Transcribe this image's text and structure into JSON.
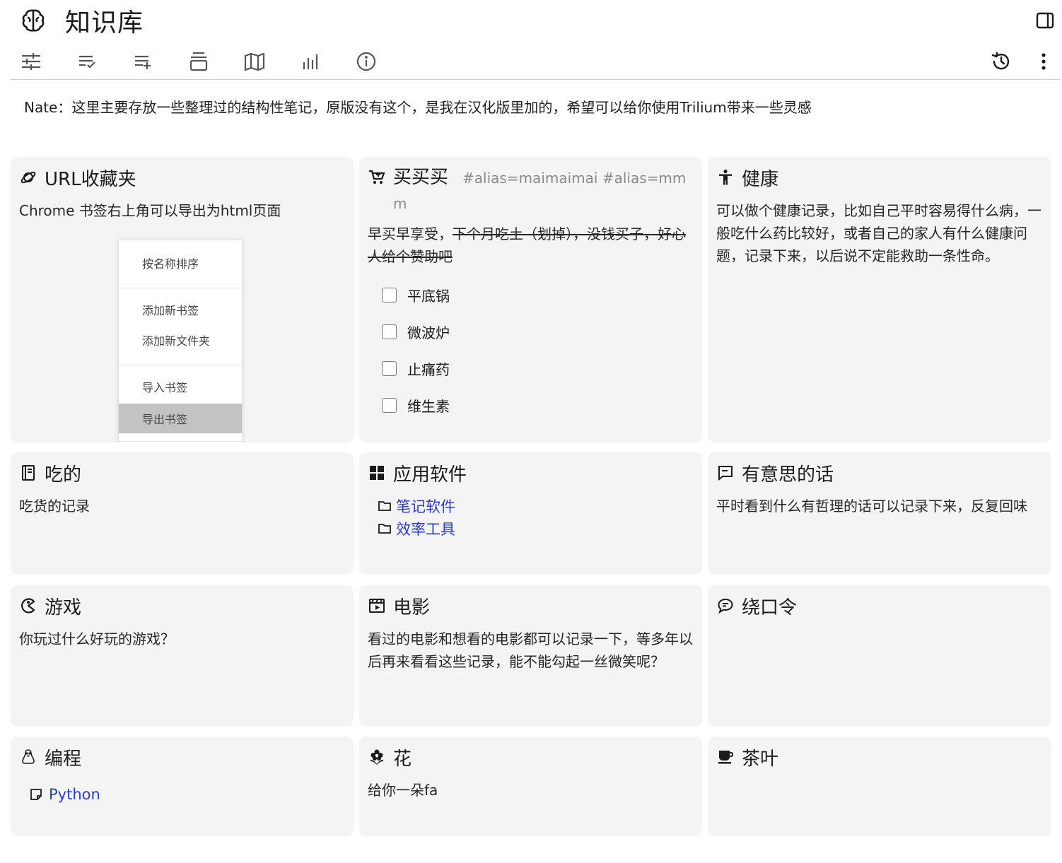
{
  "header": {
    "title": "知识库",
    "title_icon": "brain-icon",
    "sidebar_toggle_icon": "sidebar-toggle-icon"
  },
  "toolbar": {
    "left_icons": [
      "sliders-icon",
      "list-check-icon",
      "list-add-icon",
      "archive-icon",
      "map-icon",
      "bar-chart-icon",
      "info-icon"
    ],
    "right_icons": [
      "history-icon",
      "more-vertical-icon"
    ]
  },
  "note": "Nate：这里主要存放一些整理过的结构性笔记，原版没有这个，是我在汉化版里加的，希望可以给你使用Trilium带来一些灵感",
  "cards": {
    "url": {
      "title": "URL收藏夹",
      "icon": "planet-icon",
      "text": "Chrome 书签右上角可以导出为html页面",
      "menu": [
        "按名称排序",
        "添加新书签",
        "添加新文件夹",
        "导入书签",
        "导出书签"
      ]
    },
    "buy": {
      "title": "买买买",
      "icon": "cart-icon",
      "alias": "#alias=maimaimai #alias=mmm",
      "text_plain": "早买早享受，",
      "text_strike": "下个月吃土（划掉），没钱买子，好心人给个赞助吧",
      "items": [
        "平底锅",
        "微波炉",
        "止痛药",
        "维生素"
      ]
    },
    "health": {
      "title": "健康",
      "icon": "accessibility-icon",
      "text": "可以做个健康记录，比如自己平时容易得什么病，一般吃什么药比较好，或者自己的家人有什么健康问题，记录下来，以后说不定能救助一条性命。"
    },
    "food": {
      "title": "吃的",
      "icon": "notebook-icon",
      "text": "吃货的记录"
    },
    "apps": {
      "title": "应用软件",
      "icon": "windows-icon",
      "links": [
        "笔记软件",
        "效率工具"
      ]
    },
    "quotes": {
      "title": "有意思的话",
      "icon": "message-icon",
      "text": "平时看到什么有哲理的话可以记录下来，反复回味"
    },
    "games": {
      "title": "游戏",
      "icon": "pacman-icon",
      "text": "你玩过什么好玩的游戏？"
    },
    "movies": {
      "title": "电影",
      "icon": "movie-icon",
      "text": "看过的电影和想看的电影都可以记录一下，等多年以后再来看看这些记录，能不能勾起一丝微笑呢？"
    },
    "tongue": {
      "title": "绕口令",
      "icon": "chat-icon"
    },
    "code": {
      "title": "编程",
      "icon": "tux-icon",
      "links": [
        "Python"
      ]
    },
    "flower": {
      "title": "花",
      "icon": "flower-icon",
      "text": "给你一朵fa"
    },
    "tea": {
      "title": "茶叶",
      "icon": "tea-cup-icon"
    }
  }
}
